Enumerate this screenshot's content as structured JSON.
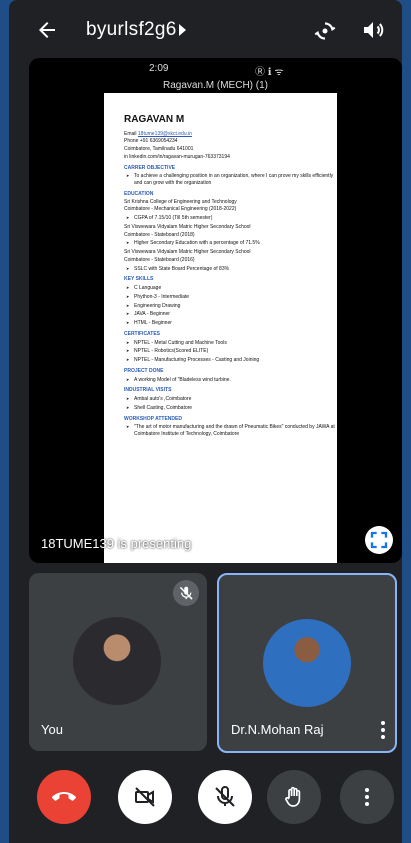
{
  "meeting": {
    "code": "byurlsf2g6"
  },
  "presentation": {
    "phone_time": "2:09",
    "phone_icons": "Ⓡ ℹ︎ ᯤ",
    "doc_title": "Ragavan.M (MECH) (1)",
    "presenter_text": "18TUME139 is presenting",
    "resume": {
      "name": "RAGAVAN M",
      "email_label": "Email",
      "email": "18tume139@skct.edu.in",
      "phone": "Phone +91 6369054234",
      "address": "Coimbatore, Tamilnadu 641001",
      "linkedin": "in linkedin.com/in/ragavan-murugan-763373194",
      "sections": [
        {
          "heading": "CARRER OBJECTIVE",
          "lines": [
            {
              "type": "bullet",
              "text": "To achieve a challenging position in an organization, where I can prove my skills efficiently and can grow with the organization"
            }
          ]
        },
        {
          "heading": "EDUCATION",
          "lines": [
            {
              "type": "plain",
              "text": "Sri Krishna College of Engineering and Technology"
            },
            {
              "type": "plain",
              "text": "Coimbatore - Mechanical Engineering (2018-2022)"
            },
            {
              "type": "bullet",
              "text": "CGPA of 7.15/10 (Till 5th semester)"
            },
            {
              "type": "plain",
              "text": "Sri Viswewara Vidyalam Matric Higher Secondary School"
            },
            {
              "type": "plain",
              "text": "Coimbatore - Stateboard (2018)"
            },
            {
              "type": "bullet",
              "text": "Higher Secondary Education with a percentage of 71.5%"
            },
            {
              "type": "plain",
              "text": "Sri Viswewara Vidyalam Matric Higher Secondary School"
            },
            {
              "type": "plain",
              "text": "Coimbatore - Stateboard (2016)"
            },
            {
              "type": "bullet",
              "text": "SSLC with State Board Percentage of 83%"
            }
          ]
        },
        {
          "heading": "KEY SKILLS",
          "lines": [
            {
              "type": "bullet",
              "text": "C Language"
            },
            {
              "type": "bullet",
              "text": "Phython-3 - Intermediate"
            },
            {
              "type": "bullet",
              "text": "Engineering Drawing"
            },
            {
              "type": "bullet",
              "text": "JAVA - Beginner"
            },
            {
              "type": "bullet",
              "text": "HTML - Beginner"
            }
          ]
        },
        {
          "heading": "CERTIFICATES",
          "lines": [
            {
              "type": "bullet",
              "text": "NPTEL - Metal Cutting and Machine Tools"
            },
            {
              "type": "bullet",
              "text": "NPTEL - Robotics(Scored ELITE)"
            },
            {
              "type": "bullet",
              "text": "NPTEL - Manufacturing Processes - Casting and Joining"
            }
          ]
        },
        {
          "heading": "PROJECT DONE",
          "lines": [
            {
              "type": "bullet",
              "text": "A working Model of \"Bladeless wind turbine."
            }
          ]
        },
        {
          "heading": "INDUSTRIAL VISITS",
          "lines": [
            {
              "type": "bullet",
              "text": "Ambal auto's ,Coimbatore"
            },
            {
              "type": "bullet",
              "text": "Shell Casting, Coimbatore"
            }
          ]
        },
        {
          "heading": "WORKSHOP ATTENDED",
          "lines": [
            {
              "type": "bullet",
              "text": "\"The art of motor manufacturing and the drawn of Pneumatic Bikes\" conducted by JAWA at Coimbatore Institute of Technology, Coimbatore"
            }
          ]
        }
      ]
    }
  },
  "participants": [
    {
      "name": "You"
    },
    {
      "name": "Dr.N.Mohan Raj"
    }
  ],
  "colors": {
    "end_call": "#ea4335",
    "active_speaker_border": "#8ab4f8",
    "section_heading": "#2b5bb6"
  },
  "icons": [
    "back-arrow-icon",
    "caret-right-icon",
    "switch-camera-icon",
    "volume-icon",
    "fullscreen-icon",
    "mic-off-icon",
    "more-vert-icon",
    "end-call-icon",
    "camera-off-icon",
    "raise-hand-icon"
  ]
}
